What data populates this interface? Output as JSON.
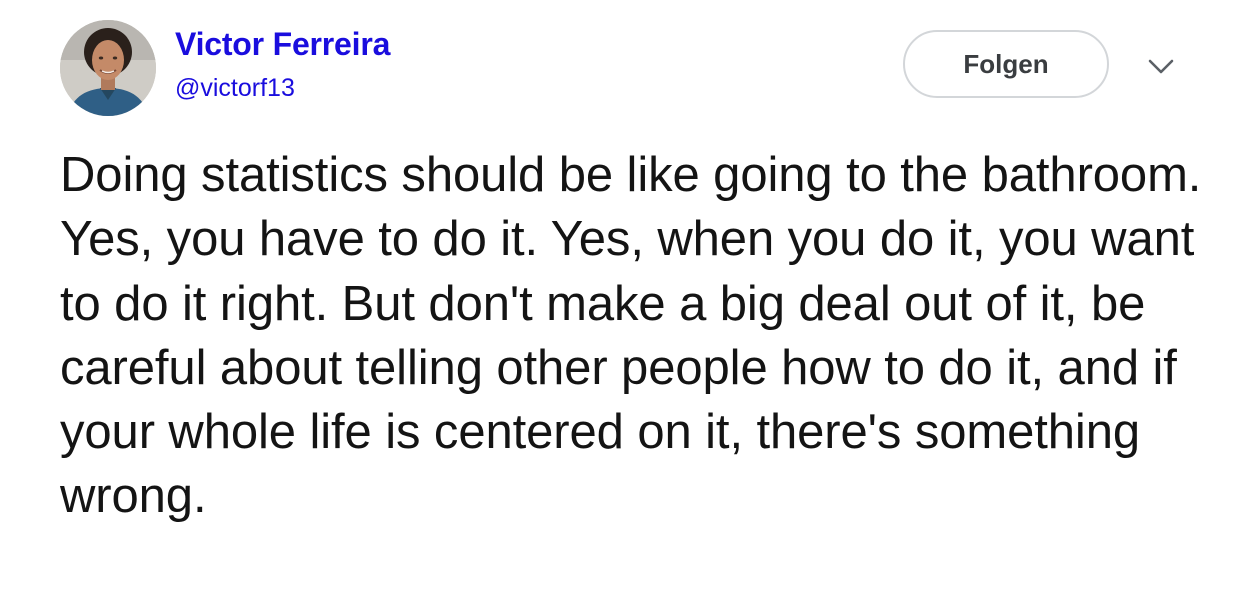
{
  "author": {
    "display_name": "Victor Ferreira",
    "handle": "@victorf13"
  },
  "actions": {
    "follow_label": "Folgen",
    "menu_icon": "chevron-down-icon"
  },
  "tweet": {
    "text": "Doing statistics should be like going to the bathroom. Yes, you have to do it. Yes, when you do it, you want to do it right. But don't make a big deal out of it, be careful about telling other people how to do it, and if your whole life is centered on it, there's something wrong."
  },
  "colors": {
    "name_link": "#1a0dde",
    "text": "#141414",
    "button_border": "#d3d6d9"
  }
}
